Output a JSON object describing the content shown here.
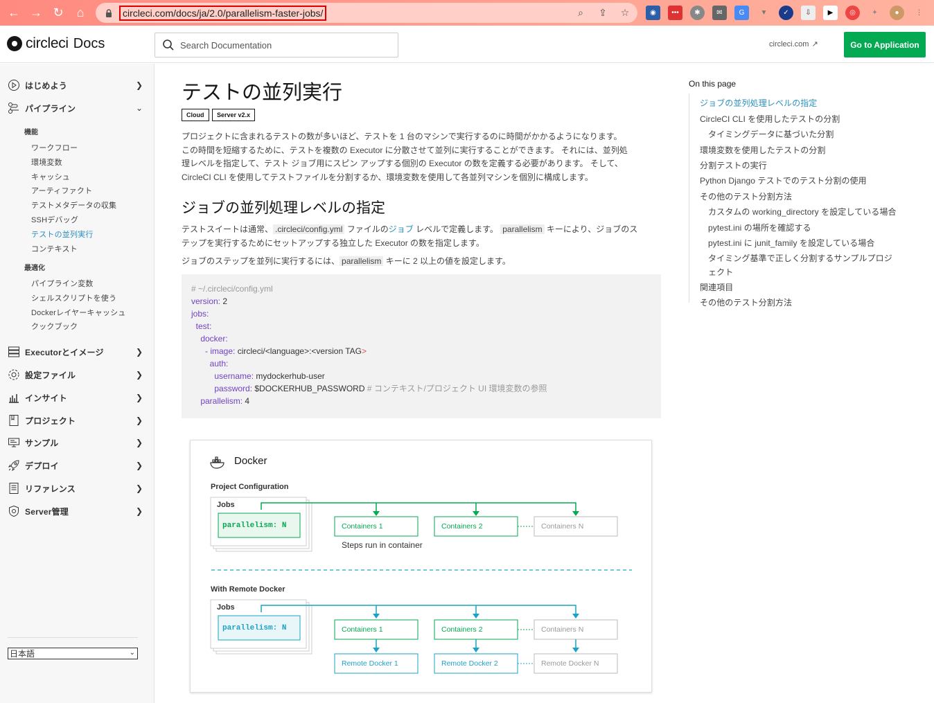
{
  "browser": {
    "url": "circleci.com/docs/ja/2.0/parallelism-faster-jobs/"
  },
  "header": {
    "logo_text": "circleci",
    "logo_docs": "Docs",
    "search_placeholder": "Search Documentation",
    "circleci_link": "circleci.com",
    "go_app_label": "Go to Application"
  },
  "sidebar": {
    "top": [
      {
        "label": "はじめよう"
      },
      {
        "label": "パイプライン"
      },
      {
        "label": "Executorとイメージ"
      },
      {
        "label": "設定ファイル"
      },
      {
        "label": "インサイト"
      },
      {
        "label": "プロジェクト"
      },
      {
        "label": "サンプル"
      },
      {
        "label": "デプロイ"
      },
      {
        "label": "リファレンス"
      },
      {
        "label": "Server管理"
      }
    ],
    "section_features": "機能",
    "features": [
      "ワークフロー",
      "環境変数",
      "キャッシュ",
      "アーティファクト",
      "テストメタデータの収集",
      "SSHデバッグ",
      "テストの並列実行",
      "コンテキスト"
    ],
    "section_optimize": "最適化",
    "optimize": [
      "パイプライン変数",
      "シェルスクリプトを使う",
      "Dockerレイヤーキャッシュ",
      "クックブック"
    ],
    "language": "日本語"
  },
  "main": {
    "title": "テストの並列実行",
    "badge_cloud": "Cloud",
    "badge_server": "Server v2.x",
    "intro_1": "プロジェクトに含まれるテストの数が多いほど、テストを 1 台のマシンで実行するのに時間がかかるようになります。",
    "intro_2": "この時間を短縮するために、テストを複数の Executor に分散させて並列に実行することができます。 それには、並列処",
    "intro_3": "理レベルを指定して、テスト ジョブ用にスピン アップする個別の Executor の数を定義する必要があります。 そして、",
    "intro_4": "CircleCI CLI を使用してテストファイルを分割するか、環境変数を使用して各並列マシンを個別に構成します。",
    "h2": "ジョブの並列処理レベルの指定",
    "p2_a": "テストスイートは通常、",
    "p2_code": ".circleci/config.yml",
    "p2_b": " ファイルの",
    "p2_link": "ジョブ",
    "p2_c": " レベルで定義します。 ",
    "p2_code2": "parallelism",
    "p2_d": " キーにより、ジョブのス",
    "p2_e": "テップを実行するためにセットアップする独立した Executor の数を指定します。",
    "p3_a": "ジョブのステップを並列に実行するには、",
    "p3_code": "parallelism",
    "p3_b": " キーに 2 以上の値を設定します。",
    "code": {
      "l1": "# ~/.circleci/config.yml",
      "l2k": "version:",
      "l2v": " 2",
      "l3k": "jobs:",
      "l4k": "  test:",
      "l5k": "    docker:",
      "l6k": "      - image:",
      "l6v": " circleci/<language>:<version TAG",
      "l7k": "        auth:",
      "l8k": "          username:",
      "l8v": " mydockerhub-user",
      "l9k": "          password:",
      "l9v": " $DOCKERHUB_PASSWORD",
      "l9c": " # コンテキスト/プロジェクト UI 環境変数の参照",
      "l10k": "    parallelism:",
      "l10v": " 4"
    }
  },
  "diagram": {
    "title": "Docker",
    "section1": "Project Configuration",
    "section2": "With Remote Docker",
    "jobs": "Jobs",
    "parallelism": "parallelism: N",
    "c1": "Containers 1",
    "c2": "Containers 2",
    "cn": "Containers N",
    "steps": "Steps run in container",
    "r1": "Remote Docker 1",
    "r2": "Remote Docker 2",
    "rn": "Remote Docker N",
    "green": "#04aa51",
    "blue": "#1aa3c4"
  },
  "toc": {
    "title": "On this page",
    "items": [
      "ジョブの並列処理レベルの指定",
      "CircleCI CLI を使用したテストの分割",
      "タイミングデータに基づいた分割",
      "環境変数を使用したテストの分割",
      "分割テストの実行",
      "Python Django テストでのテスト分割の使用",
      "その他のテスト分割方法",
      "カスタムの working_directory を設定している場合",
      "pytest.ini の場所を確認する",
      "pytest.ini に junit_family を設定している場合",
      "タイミング基準で正しく分割するサンプルプロジ",
      "ェクト",
      "関連項目",
      "その他のテスト分割方法"
    ]
  }
}
